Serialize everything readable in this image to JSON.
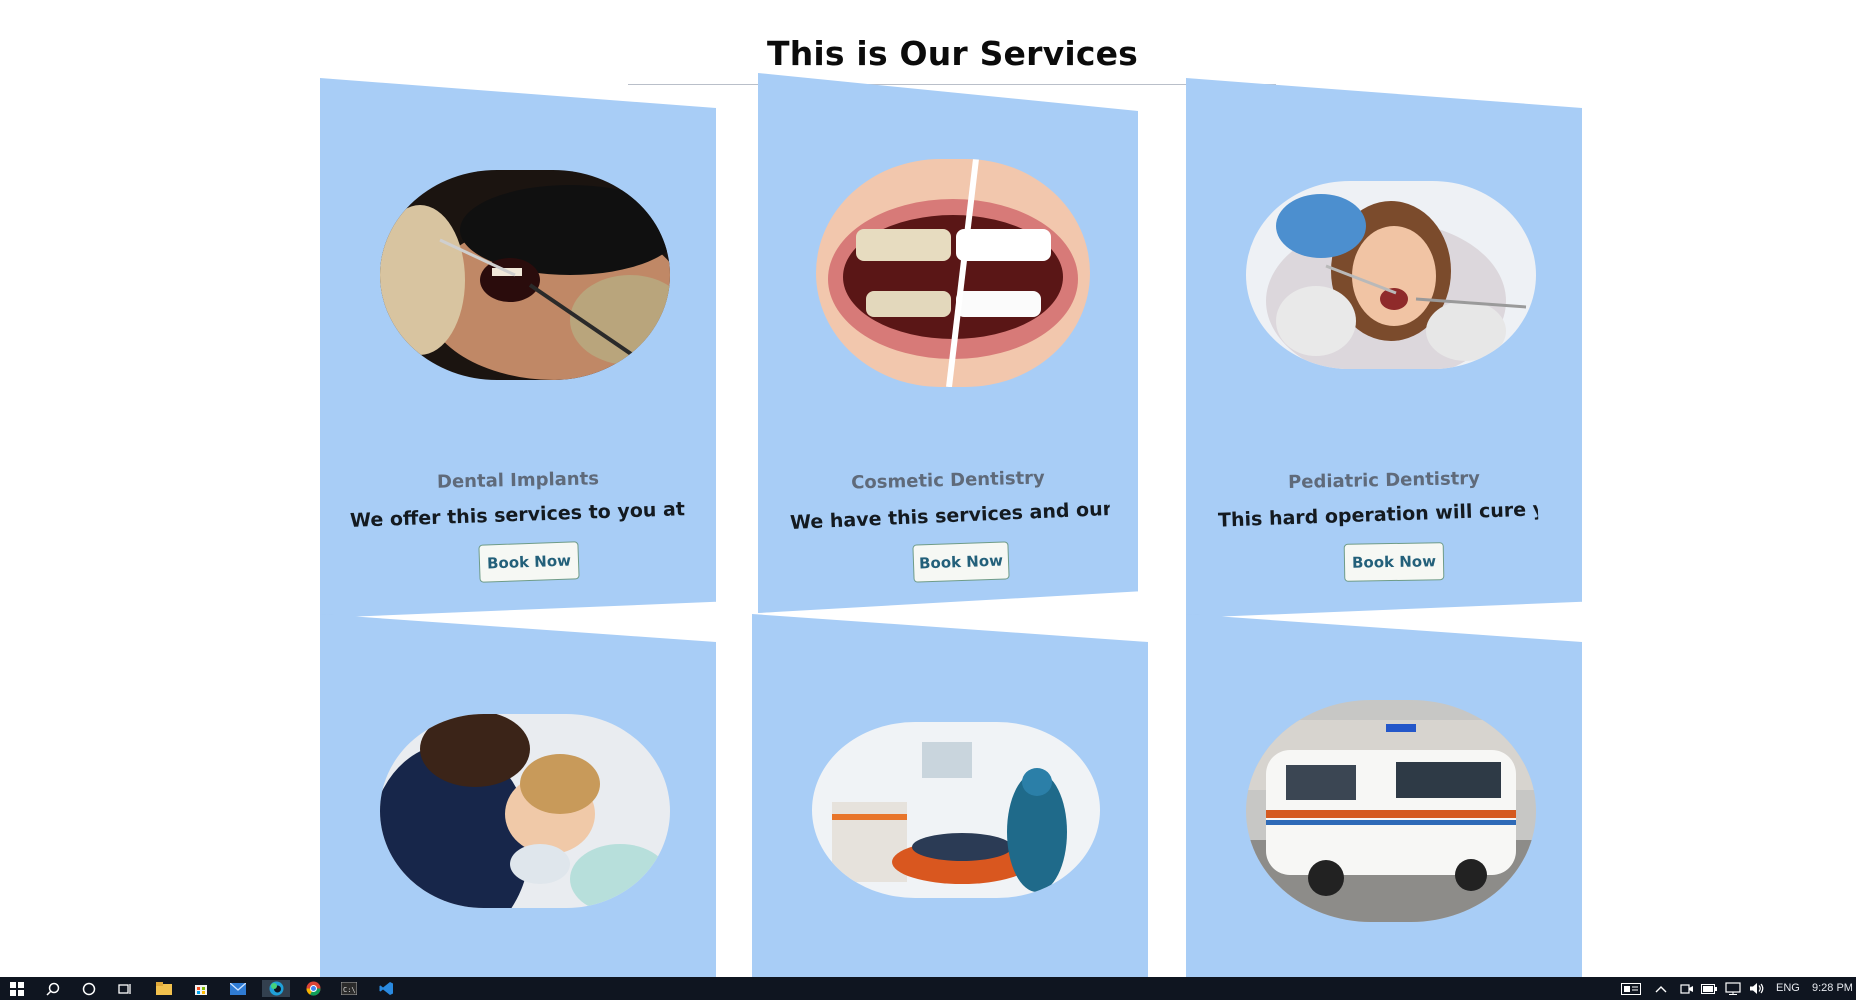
{
  "page": {
    "title": "This is Our Services"
  },
  "cards": [
    {
      "heading": "Dental Implants",
      "text": "We offer this services to you at very lo",
      "button": "Book Now",
      "image": "dental-procedure-photo"
    },
    {
      "heading": "Cosmetic Dentistry",
      "text": "We have this services and our best surg",
      "button": "Book Now",
      "image": "teeth-whitening-photo"
    },
    {
      "heading": "Pediatric Dentistry",
      "text": "This hard operation will cure you in a b",
      "button": "Book Now",
      "image": "child-dental-exam-photo"
    },
    {
      "image": "dental-cleaning-photo"
    },
    {
      "image": "dental-clinic-photo"
    },
    {
      "image": "ambulance-photo"
    }
  ],
  "taskbar": {
    "icons": [
      "windows-start-icon",
      "search-icon",
      "cortana-icon",
      "task-view-icon",
      "file-explorer-icon",
      "store-icon",
      "mail-icon",
      "edge-icon",
      "chrome-icon",
      "terminal-icon",
      "vscode-icon"
    ],
    "tray_icons": [
      "news-icon",
      "chevron-up-icon",
      "meet-now-icon",
      "battery-icon",
      "network-icon",
      "volume-icon"
    ],
    "language": "ENG",
    "time": "9:28 PM"
  },
  "colors": {
    "card": "#a8cdf6",
    "taskbar": "#0f1520",
    "button_text": "#23607a"
  }
}
